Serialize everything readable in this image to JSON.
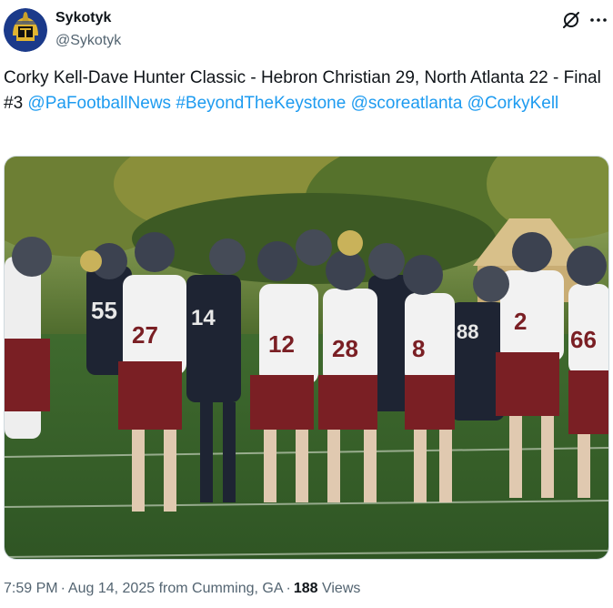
{
  "author": {
    "name": "Sykotyk",
    "handle": "@Sykotyk",
    "avatar_icon": "trojan-helmet-avatar"
  },
  "header_icons": [
    "grok-icon",
    "more-icon"
  ],
  "tweet": {
    "text_plain": "Corky Kell-Dave Hunter Classic - Hebron Christian 29, North Atlanta 22 - Final #3",
    "links": [
      "@PaFootballNews",
      "#BeyondTheKeystone",
      "@scoreatlanta",
      "@CorkyKell"
    ]
  },
  "media": {
    "jersey_numbers": [
      "55",
      "27",
      "14",
      "12",
      "28",
      "8",
      "88",
      "2",
      "66"
    ]
  },
  "meta": {
    "time": "7:59 PM",
    "date": "Aug 14, 2025",
    "location": "from Cumming, GA",
    "views_count": "188",
    "views_label": "Views"
  },
  "colors": {
    "link": "#1d9bf0",
    "secondary_text": "#536471",
    "maroon": "#7a1f24",
    "navy": "#1e2433"
  }
}
